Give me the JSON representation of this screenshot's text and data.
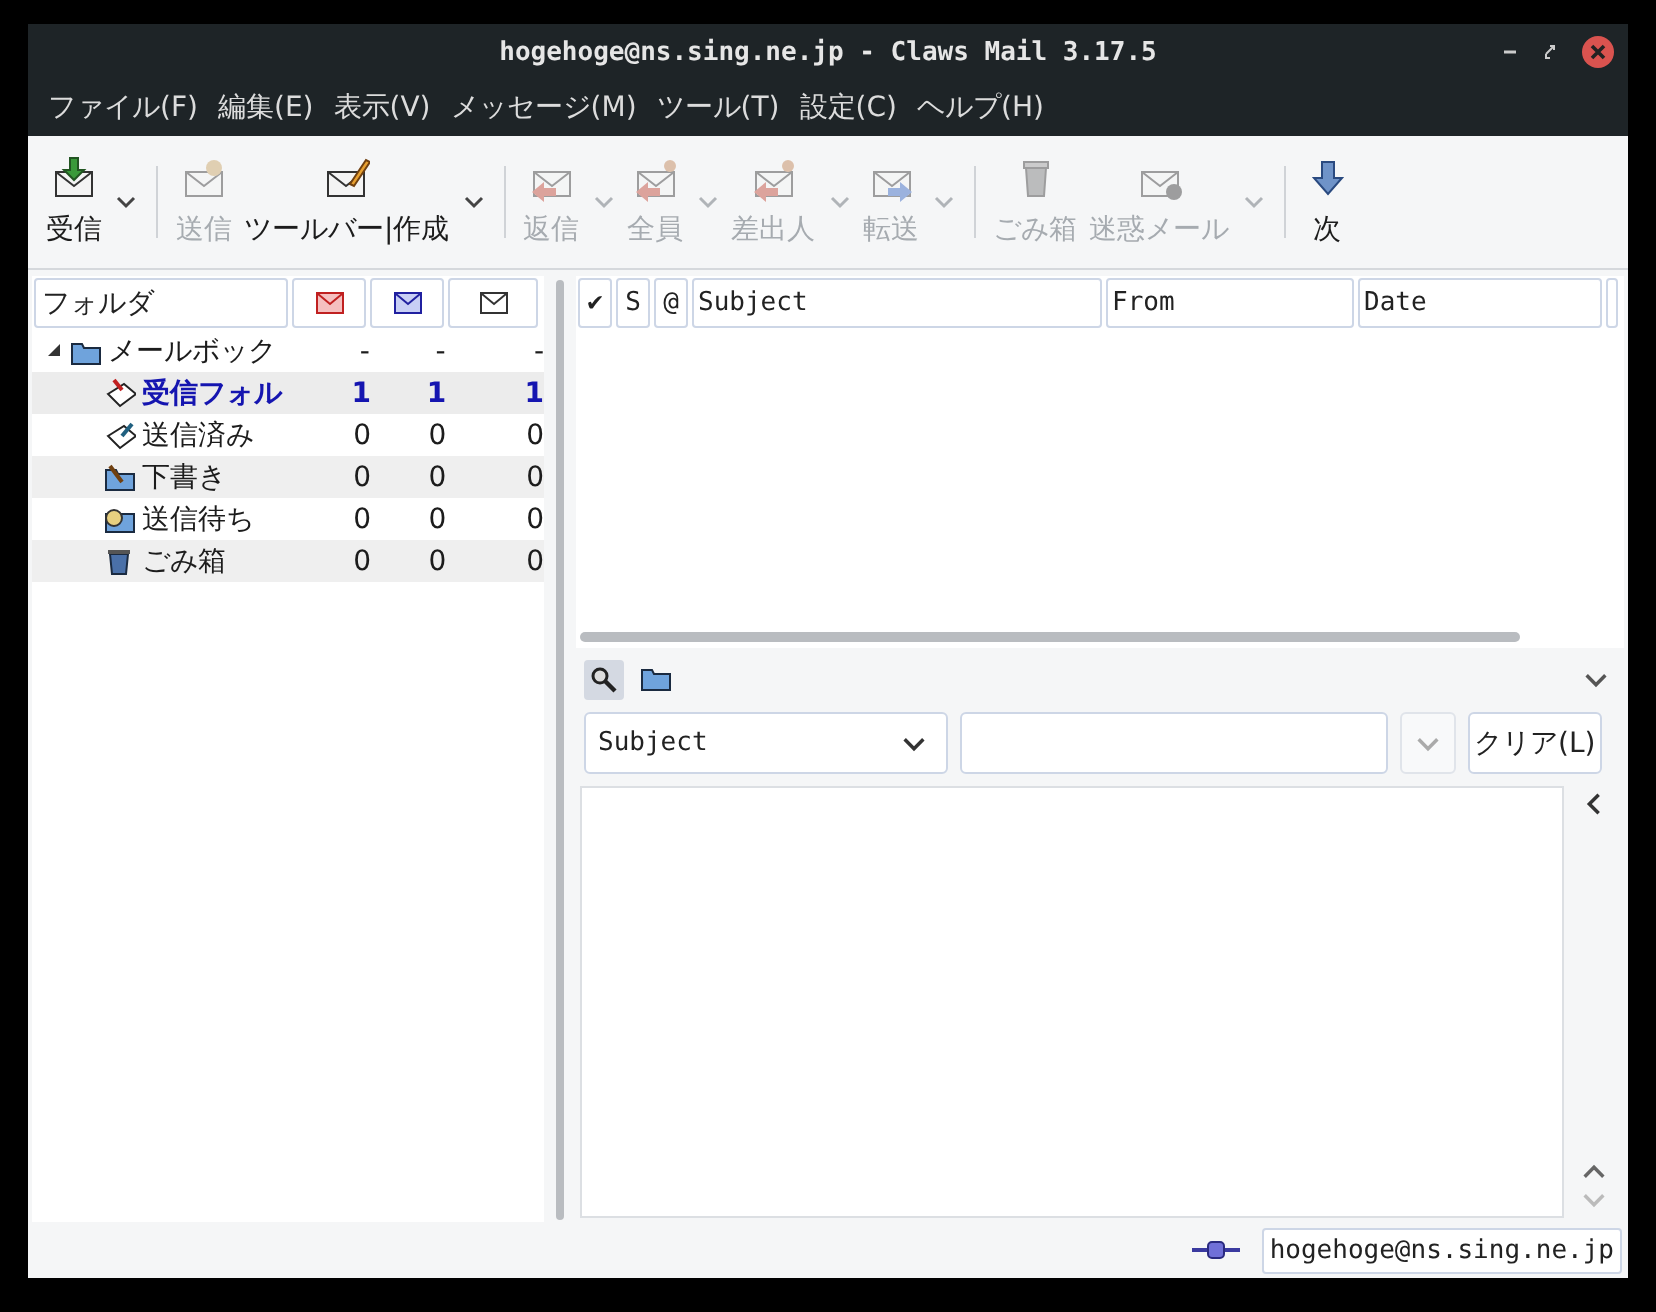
{
  "window": {
    "title": "hogehoge@ns.sing.ne.jp - Claws Mail 3.17.5"
  },
  "menu": [
    "ファイル(F)",
    "編集(E)",
    "表示(V)",
    "メッセージ(M)",
    "ツール(T)",
    "設定(C)",
    "ヘルプ(H)"
  ],
  "toolbar": [
    {
      "kind": "button",
      "label": "受信",
      "disabled": false,
      "dropdown": true
    },
    {
      "kind": "separator"
    },
    {
      "kind": "button",
      "label": "送信",
      "disabled": true,
      "dropdown": false
    },
    {
      "kind": "button",
      "label": "ツールバー|作成",
      "disabled": false,
      "dropdown": true
    },
    {
      "kind": "separator"
    },
    {
      "kind": "button",
      "label": "返信",
      "disabled": true,
      "dropdown": true
    },
    {
      "kind": "button",
      "label": "全員",
      "disabled": true,
      "dropdown": true
    },
    {
      "kind": "button",
      "label": "差出人",
      "disabled": true,
      "dropdown": true
    },
    {
      "kind": "button",
      "label": "転送",
      "disabled": true,
      "dropdown": true
    },
    {
      "kind": "separator"
    },
    {
      "kind": "button",
      "label": "ごみ箱",
      "disabled": true,
      "dropdown": false
    },
    {
      "kind": "button",
      "label": "迷惑メール",
      "disabled": true,
      "dropdown": true
    },
    {
      "kind": "separator"
    },
    {
      "kind": "button",
      "label": "次",
      "disabled": false,
      "dropdown": false
    }
  ],
  "folder_tree": {
    "columns": [
      {
        "kind": "label",
        "label": "フォルダ"
      },
      {
        "kind": "new"
      },
      {
        "kind": "unread"
      },
      {
        "kind": "total"
      }
    ],
    "items": [
      {
        "name": "メールボック",
        "new": "-",
        "unread": "-",
        "total": "-",
        "expanded": true,
        "selected": false,
        "children": [
          {
            "name": "受信フォル",
            "new": "1",
            "unread": "1",
            "total": "1",
            "selected": true
          },
          {
            "name": "送信済み",
            "new": "0",
            "unread": "0",
            "total": "0",
            "selected": false
          },
          {
            "name": "下書き",
            "new": "0",
            "unread": "0",
            "total": "0",
            "selected": false
          },
          {
            "name": "送信待ち",
            "new": "0",
            "unread": "0",
            "total": "0",
            "selected": false
          },
          {
            "name": "ごみ箱",
            "new": "0",
            "unread": "0",
            "total": "0",
            "selected": false
          }
        ]
      }
    ]
  },
  "message_list": {
    "columns": [
      {
        "kind": "check",
        "label": "✔"
      },
      {
        "kind": "narrow",
        "label": "S"
      },
      {
        "kind": "narrow",
        "label": "@"
      },
      {
        "kind": "text",
        "label": "Subject"
      },
      {
        "kind": "text",
        "label": "From"
      },
      {
        "kind": "text",
        "label": "Date"
      }
    ]
  },
  "quick_search": {
    "field": "Subject",
    "clear": "クリア(L)"
  },
  "status_bar": {
    "account": "hogehoge@ns.sing.ne.jp"
  }
}
